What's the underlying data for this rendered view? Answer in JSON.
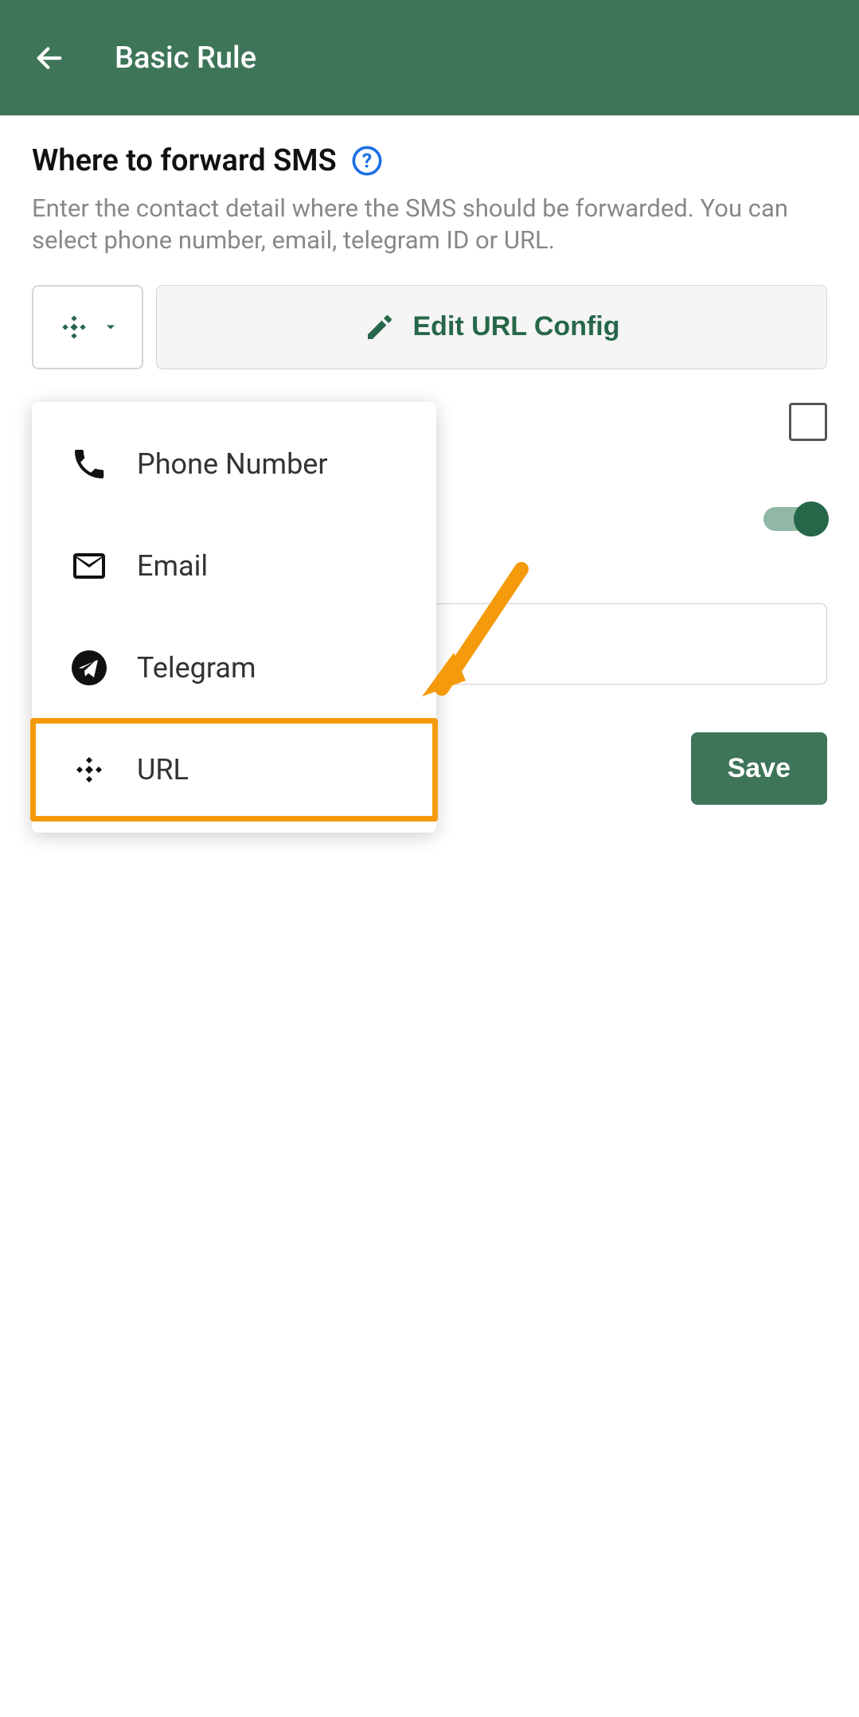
{
  "header": {
    "title": "Basic Rule"
  },
  "section": {
    "title": "Where to forward SMS",
    "description": "Enter the contact detail where the SMS should be forwarded. You can select phone number, email, telegram ID or URL."
  },
  "controls": {
    "edit_config_label": "Edit URL Config",
    "save_label": "Save"
  },
  "dropdown": {
    "items": [
      {
        "label": "Phone Number",
        "icon": "phone"
      },
      {
        "label": "Email",
        "icon": "email"
      },
      {
        "label": "Telegram",
        "icon": "telegram"
      },
      {
        "label": "URL",
        "icon": "url"
      }
    ],
    "highlighted_index": 3
  },
  "colors": {
    "primary": "#3e7559",
    "accent_highlight": "#f59b0b",
    "help_blue": "#1d6fe8"
  }
}
